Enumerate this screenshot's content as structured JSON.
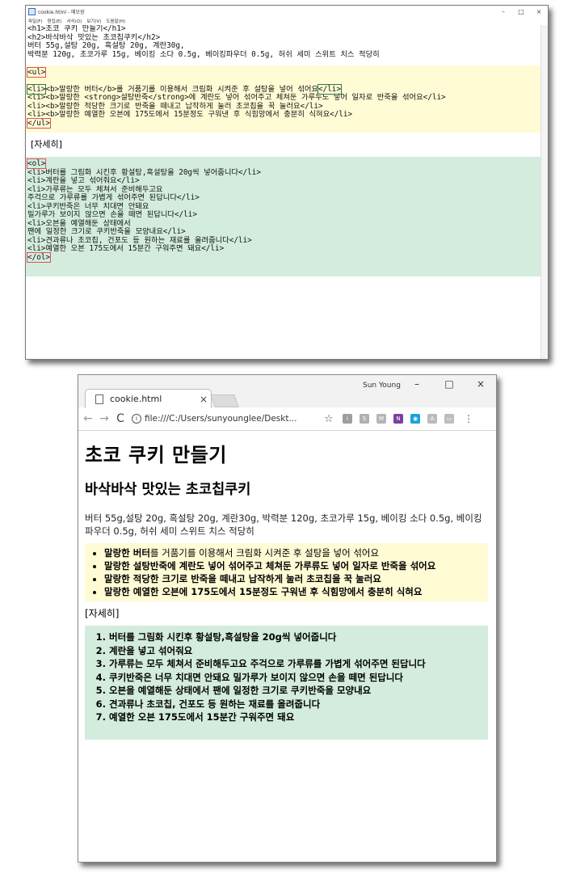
{
  "notepad": {
    "title": "cookie.html - 메모장",
    "menu": [
      "파일(F)",
      "편집(E)",
      "서식(O)",
      "보기(V)",
      "도움말(H)"
    ],
    "controls": {
      "minimize": "–",
      "maximize": "□",
      "close": "×"
    },
    "header_lines": [
      "<h1>초코 쿠키 만들기</h1>",
      "<h2>바삭바삭 맛있는 초코칩쿠키</h2>",
      "버터 55g,설탕 20g, 흑설탕 20g, 계란30g,",
      "박력분 120g, 초코가루 15g, 베이킹 소다 0.5g, 베이킹파우더 0.5g, 허쉬 세미 스위트 치스 적당히"
    ],
    "ul_open": "<ul>",
    "ul_first_tag": "<li>",
    "ul_first_rest": "<b>말랑한 버터</b>를 거품기를 이용해서 크림화 시켜준 후 설탕을 넣어 섞어요",
    "ul_first_close": "</li>",
    "ul_lines": [
      "<li><b>말랑한 <strong>설탕반죽</strong>에 계란도 넣어 섞어주고 체쳐둔 가루두도 넣어 일자로 반죽을 섞어요</li>",
      "<li><b>말랑한 적당한 크기로 반죽을 떼내고 납작하게 눌러 초코칩을 꾹 눌러요</li>",
      "<li><b>말랑한 예열한 오븐에 175도에서 15분정도 구워낸 후 식힘망에서 충분히 식혀요</li>"
    ],
    "ul_close": "</ul>",
    "detail": "[자세히]",
    "ol_open": "<ol>",
    "ol_lines": [
      "<li>버터를 그림화 시킨후 황설탕,흑설탕을 20g씩 넣어줍니다</li>",
      "<li>계란을 넣고 섞어줘요</li>",
      "<li>가루류는 모두 체쳐서 준비해두고요",
      "주걱으로 가루류를 가볍게 섞어주면 된답니다</li>",
      "<li>쿠키반죽은 너무 치대면 안돼요",
      "밀가루가 보이지 않으면 손을 떼면 된답니다</li>",
      "<li>오븐을 예열해둔 상태에서",
      "팬에 일정한 크기로 쿠키반죽을 모양내요</li>",
      "<li>견과류나 초코칩, 건포도 등 원하는 재료를 올려줍니다</li>",
      "<li>예열한 오븐 175도에서 15분간 구워주면 돼요</li>"
    ],
    "ol_close": "</ol>"
  },
  "browser": {
    "tab_title": "cookie.html",
    "tab_close": "×",
    "user_name": "Sun Young",
    "controls": {
      "minimize": "–",
      "maximize": "□",
      "close": "×"
    },
    "nav": {
      "back": "←",
      "forward": "→",
      "reload": "C"
    },
    "info_glyph": "i",
    "url": "file:///C:/Users/sunyounglee/Deskt...",
    "star": "☆",
    "extensions": [
      {
        "label": "i",
        "color": "#9e9e9e"
      },
      {
        "label": "S",
        "color": "#b0b0b0"
      },
      {
        "label": "M",
        "color": "#b5b5b5"
      },
      {
        "label": "N",
        "color": "#7a3fa0"
      },
      {
        "label": "◉",
        "color": "#1aa0e0"
      },
      {
        "label": "A",
        "color": "#bbbbbb"
      },
      {
        "label": "▭",
        "color": "#bdbdbd"
      }
    ],
    "menu": "⋮",
    "page": {
      "h1": "초코 쿠키 만들기",
      "h2": "바삭바삭 맛있는 초코칩쿠키",
      "ingredients": "버터 55g,설탕 20g, 흑설탕 20g, 계란30g, 박력분 120g, 초코가루 15g, 베이킹 소다 0.5g, 베이킹파우더 0.5g, 허쉬 세미 스위트 치스 적당히",
      "ul_items": [
        {
          "bold": "말랑한 버터",
          "rest": "를 거품기를 이용해서 크림화 시켜준 후 설탕을 넣어 섞어요"
        },
        {
          "bold": "말랑한 설탕반죽에 계란도 넣어 섞어주고 체쳐둔 가루류도 넣어 일자로 반죽을 섞어요",
          "rest": ""
        },
        {
          "bold": "말랑한 적당한 크기로 반죽을 떼내고 납작하게 눌러 초코칩을 꾹 눌러요",
          "rest": ""
        },
        {
          "bold": "말랑한 예열한 오븐에 175도에서 15분정도 구워낸 후 식힘망에서 충분히 식혀요",
          "rest": ""
        }
      ],
      "detail": "[자세히]",
      "ol_items": [
        "버터를 그림화 시킨후 황설탕,흑설탕을 20g씩 넣어줍니다",
        "계란을 넣고 섞어줘요",
        "가루류는 모두 체쳐서 준비해두고요 주걱으로 가루류를 가볍게 섞어주면 된답니다",
        "쿠키반죽은 너무 치대면 안돼요 밀가루가 보이지 않으면 손을 떼면 된답니다",
        "오븐을 예열해둔 상태에서 팬에 일정한 크기로 쿠키반죽을 모양내요",
        "견과류나 초코칩, 건포도 등 원하는 재료를 올려줍니다",
        "예열한 오븐 175도에서 15분간 구워주면 돼요"
      ]
    }
  }
}
